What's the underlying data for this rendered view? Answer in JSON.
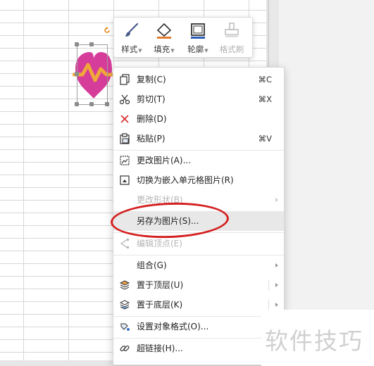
{
  "mini_toolbar": {
    "style": {
      "label": "样式",
      "icon": "brush-icon"
    },
    "fill": {
      "label": "填充",
      "icon": "paint-bucket-icon"
    },
    "outline": {
      "label": "轮廓",
      "icon": "outline-square-icon"
    },
    "format_painter": {
      "label": "格式刷",
      "icon": "format-painter-icon"
    }
  },
  "context_menu": {
    "copy": {
      "label": "复制(C)",
      "shortcut": "⌘C"
    },
    "cut": {
      "label": "剪切(T)",
      "shortcut": "⌘X"
    },
    "delete": {
      "label": "删除(D)"
    },
    "paste": {
      "label": "粘贴(P)",
      "shortcut": "⌘V"
    },
    "change_picture": {
      "label": "更改图片(A)..."
    },
    "embed_in_cell": {
      "label": "切换为嵌入单元格图片(R)"
    },
    "change_shape": {
      "label": "更改形状(B)"
    },
    "save_as_picture": {
      "label": "另存为图片(S)..."
    },
    "edit_points": {
      "label": "编辑顶点(E)"
    },
    "group": {
      "label": "组合(G)"
    },
    "bring_to_front": {
      "label": "置于顶层(U)"
    },
    "send_to_back": {
      "label": "置于底层(K)"
    },
    "format_object": {
      "label": "设置对象格式(O)..."
    },
    "hyperlink": {
      "label": "超链接(H)...",
      "shortcut": "⌘"
    }
  },
  "watermark": "软件技巧",
  "colors": {
    "heart": "#d63c9a",
    "pulse_line": "#f0a83a",
    "annotation": "#d42020"
  }
}
